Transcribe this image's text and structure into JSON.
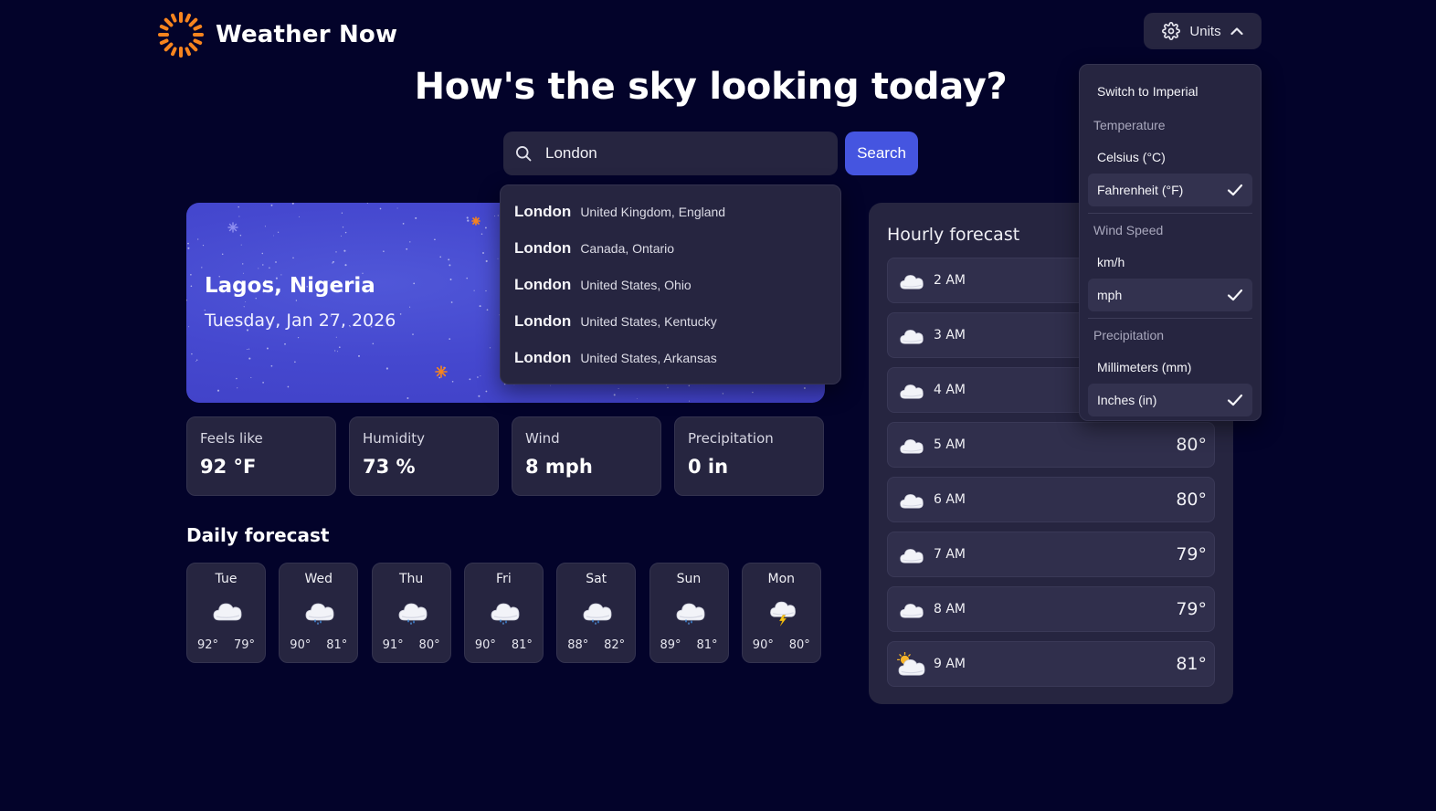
{
  "app": {
    "name": "Weather Now"
  },
  "header": {
    "units_label": "Units",
    "headline": "How's the sky looking today?"
  },
  "search": {
    "value": "London",
    "button_label": "Search"
  },
  "suggestions": [
    {
      "city": "London",
      "region": "United Kingdom, England"
    },
    {
      "city": "London",
      "region": "Canada, Ontario"
    },
    {
      "city": "London",
      "region": "United States, Ohio"
    },
    {
      "city": "London",
      "region": "United States, Kentucky"
    },
    {
      "city": "London",
      "region": "United States, Arkansas"
    }
  ],
  "current": {
    "location": "Lagos, Nigeria",
    "date": "Tuesday, Jan 27, 2026"
  },
  "stats": [
    {
      "label": "Feels like",
      "value": "92 °F"
    },
    {
      "label": "Humidity",
      "value": "73 %"
    },
    {
      "label": "Wind",
      "value": "8 mph"
    },
    {
      "label": "Precipitation",
      "value": "0 in"
    }
  ],
  "daily": {
    "title": "Daily forecast",
    "days": [
      {
        "day": "Tue",
        "high": "92°",
        "low": "79°",
        "icon": "cloud-icon"
      },
      {
        "day": "Wed",
        "high": "90°",
        "low": "81°",
        "icon": "rain-cloud-icon"
      },
      {
        "day": "Thu",
        "high": "91°",
        "low": "80°",
        "icon": "rain-cloud-icon"
      },
      {
        "day": "Fri",
        "high": "90°",
        "low": "81°",
        "icon": "rain-cloud-icon"
      },
      {
        "day": "Sat",
        "high": "88°",
        "low": "82°",
        "icon": "rain-cloud-icon"
      },
      {
        "day": "Sun",
        "high": "89°",
        "low": "81°",
        "icon": "rain-cloud-icon"
      },
      {
        "day": "Mon",
        "high": "90°",
        "low": "80°",
        "icon": "storm-cloud-icon"
      }
    ]
  },
  "hourly": {
    "title": "Hourly forecast",
    "hours": [
      {
        "time": "2 AM",
        "temp": "",
        "icon": "cloud-icon"
      },
      {
        "time": "3 AM",
        "temp": "",
        "icon": "cloud-icon"
      },
      {
        "time": "4 AM",
        "temp": "",
        "icon": "cloud-icon"
      },
      {
        "time": "5 AM",
        "temp": "80°",
        "icon": "cloud-icon"
      },
      {
        "time": "6 AM",
        "temp": "80°",
        "icon": "cloud-icon"
      },
      {
        "time": "7 AM",
        "temp": "79°",
        "icon": "cloud-icon"
      },
      {
        "time": "8 AM",
        "temp": "79°",
        "icon": "cloud-icon"
      },
      {
        "time": "9 AM",
        "temp": "81°",
        "icon": "partly-sunny-icon"
      }
    ]
  },
  "units_menu": {
    "switch_label": "Switch to Imperial",
    "temperature": {
      "label": "Temperature",
      "options": [
        "Celsius (°C)",
        "Fahrenheit (°F)"
      ],
      "selected": "Fahrenheit (°F)"
    },
    "wind": {
      "label": "Wind Speed",
      "options": [
        "km/h",
        "mph"
      ],
      "selected": "mph"
    },
    "precipitation": {
      "label": "Precipitation",
      "options": [
        "Millimeters (mm)",
        "Inches (in)"
      ],
      "selected": "Inches (in)"
    }
  },
  "colors": {
    "background": "#03032a",
    "card": "#262540",
    "accent": "#4555e0",
    "sun": "#f7841e"
  }
}
